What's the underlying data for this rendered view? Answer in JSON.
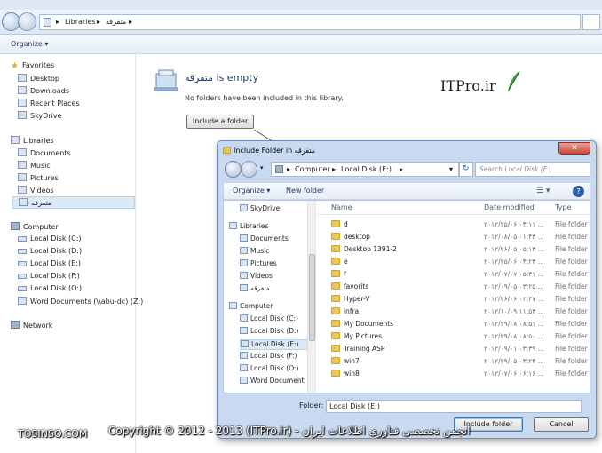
{
  "explorer": {
    "breadcrumb": [
      "Libraries",
      "متفرقه"
    ],
    "toolbar": {
      "organize": "Organize ▾"
    },
    "nav": {
      "favorites": "Favorites",
      "fav_items": [
        "Desktop",
        "Downloads",
        "Recent Places",
        "SkyDrive"
      ],
      "libraries": "Libraries",
      "lib_items": [
        "Documents",
        "Music",
        "Pictures",
        "Videos",
        "متفرقه"
      ],
      "computer": "Computer",
      "comp_items": [
        "Local Disk (C:)",
        "Local Disk (D:)",
        "Local Disk (E:)",
        "Local Disk (F:)",
        "Local Disk (O:)",
        "Word Documents (\\\\abu-dc) (Z:)"
      ],
      "network": "Network"
    },
    "content": {
      "title": "متفرقه is empty",
      "subtitle": "No folders have been included in this library.",
      "include_button": "Include a folder",
      "brand": "ITPro.ir"
    }
  },
  "dialog": {
    "title": "Include Folder in متفرقه",
    "close": "✕",
    "breadcrumb": [
      "Computer",
      "Local Disk (E:)"
    ],
    "search_placeholder": "Search Local Disk (E:)",
    "toolbar": {
      "organize": "Organize ▾",
      "new_folder": "New folder",
      "help": "?"
    },
    "nav": [
      {
        "label": "SkyDrive",
        "level": 1
      },
      {
        "label": "Libraries",
        "level": 0
      },
      {
        "label": "Documents",
        "level": 1
      },
      {
        "label": "Music",
        "level": 1
      },
      {
        "label": "Pictures",
        "level": 1
      },
      {
        "label": "Videos",
        "level": 1
      },
      {
        "label": "متفرقه",
        "level": 1
      },
      {
        "label": "Computer",
        "level": 0
      },
      {
        "label": "Local Disk (C:)",
        "level": 1
      },
      {
        "label": "Local Disk (D:)",
        "level": 1
      },
      {
        "label": "Local Disk (E:)",
        "level": 1,
        "selected": true
      },
      {
        "label": "Local Disk (F:)",
        "level": 1
      },
      {
        "label": "Local Disk (O:)",
        "level": 1
      },
      {
        "label": "Word Document",
        "level": 1
      }
    ],
    "columns": {
      "name": "Name",
      "date": "Date modified",
      "type": "Type"
    },
    "files": [
      {
        "name": "d",
        "date": "۲۰۱۲/۲۵/۰۶ ۰۴:۱۱ ...",
        "type": "File folder"
      },
      {
        "name": "desktop",
        "date": "۲۰۱۲/۰۸/۰۵ ۰۱:۴۳ ...",
        "type": "File folder"
      },
      {
        "name": "Desktop 1391-2",
        "date": "۲۰۱۲/۲۶/۰۵ ۰۵:۱۳ ...",
        "type": "File folder"
      },
      {
        "name": "e",
        "date": "۲۰۱۲/۲۵/۰۶ ۰۴:۲۳ ...",
        "type": "File folder"
      },
      {
        "name": "f",
        "date": "۲۰۱۲/۰۷/۰۷ ۰۵:۳۱ ...",
        "type": "File folder"
      },
      {
        "name": "favorits",
        "date": "۲۰۱۲/۰۹/۰۵ ۰۳:۲۵ ...",
        "type": "File folder"
      },
      {
        "name": "Hyper-V",
        "date": "۲۰۱۲/۲۶/۰۶ ۰۲:۳۷ ...",
        "type": "File folder"
      },
      {
        "name": "infra",
        "date": "۲۰۱۲/۱۰/۰۹ ۱۱:۵۳ ...",
        "type": "File folder"
      },
      {
        "name": "My Documents",
        "date": "۲۰۱۲/۲۹/۰۸ ۰۸:۵۱ ...",
        "type": "File folder"
      },
      {
        "name": "My Pictures",
        "date": "۲۰۱۲/۲۹/۰۸ ۰۸:۵۰ ...",
        "type": "File folder"
      },
      {
        "name": "Training ASP",
        "date": "۲۰۱۲/۰۹/۰۱ ۰۳:۳۹ ...",
        "type": "File folder"
      },
      {
        "name": "win7",
        "date": "۲۰۱۲/۲۹/۰۵ ۰۳:۲۴ ...",
        "type": "File folder"
      },
      {
        "name": "win8",
        "date": "۲۰۱۲/۰۷/۰۶ ۰۶:۱۶ ...",
        "type": "File folder"
      }
    ],
    "folder_label": "Folder:",
    "folder_value": "Local Disk (E:)",
    "include_button": "Include folder",
    "cancel_button": "Cancel"
  },
  "watermark": {
    "site": "TOSINSO.COM",
    "copyright": "Copyright © 2012 - 2013 (ITPro.ir) - انجمن تخصصی فناوری اطلاعات ایران"
  }
}
